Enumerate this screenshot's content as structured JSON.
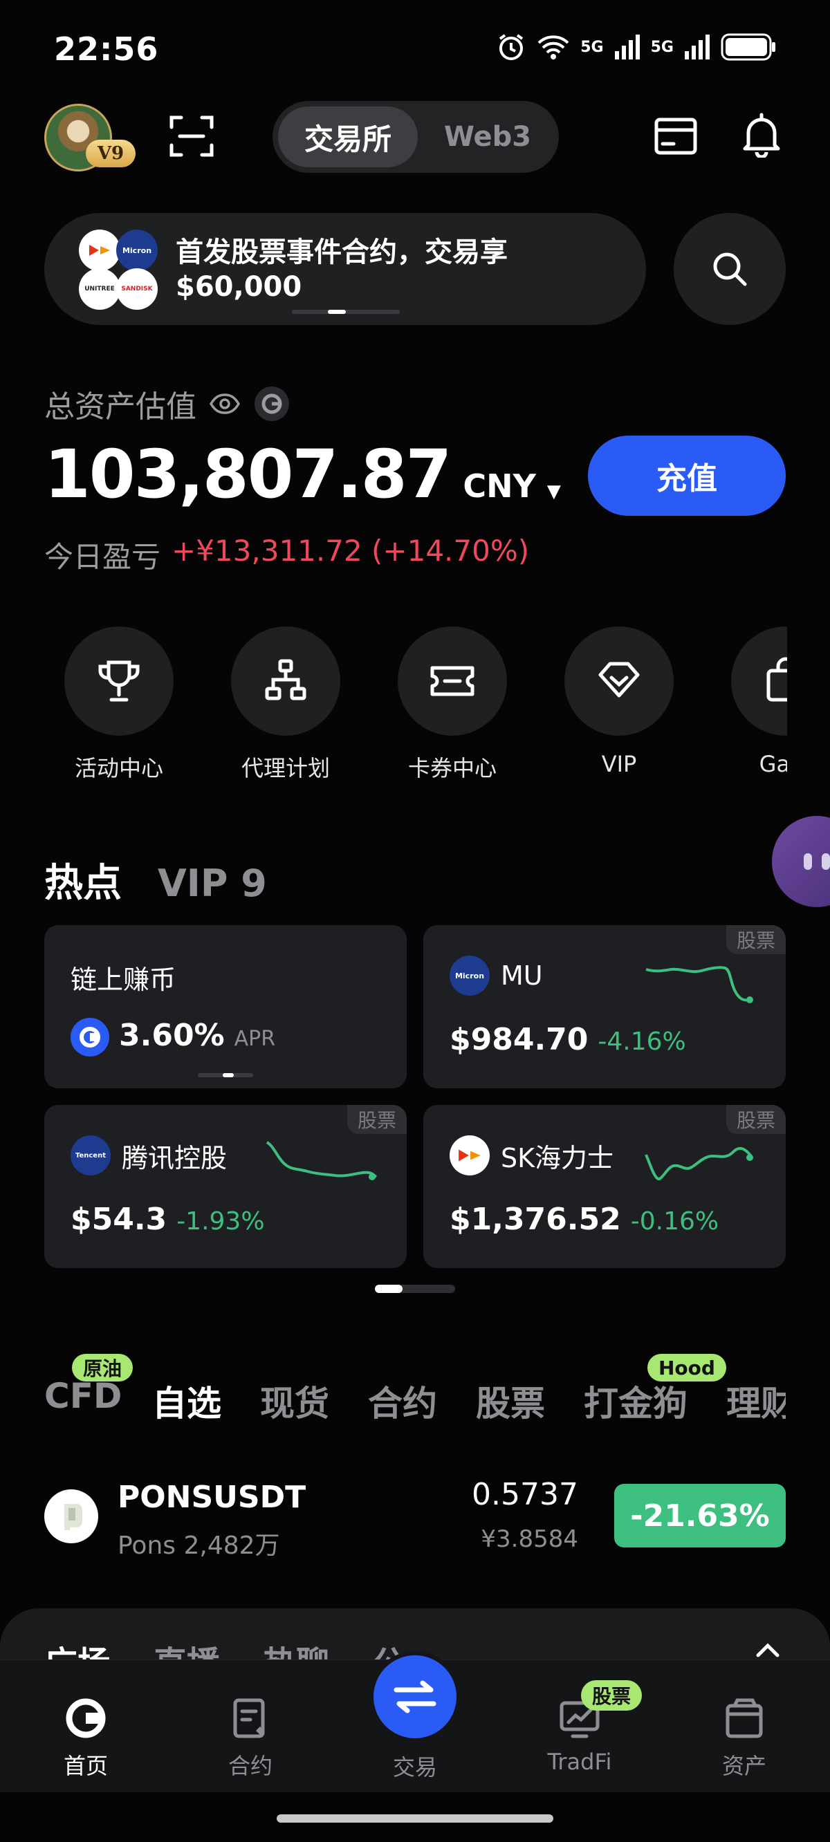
{
  "status_bar": {
    "time": "22:56",
    "signal_1": "5G",
    "signal_2": "5G"
  },
  "top_nav": {
    "vip_badge": "V9",
    "segments": {
      "active": "交易所",
      "inactive": "Web3"
    }
  },
  "banner": {
    "text": "首发股票事件合约，交易享$60,000",
    "logos": [
      "SK",
      "Micron",
      "UNITREE",
      "SANDISK"
    ]
  },
  "assets": {
    "label": "总资产估值",
    "value": "103,807.87",
    "currency": "CNY",
    "caret": "▼",
    "deposit_label": "充值",
    "pnl_label": "今日盈亏",
    "pnl_value": "+¥13,311.72 (+14.70%)"
  },
  "quick_actions": [
    {
      "label": "活动中心",
      "icon": "trophy-icon"
    },
    {
      "label": "代理计划",
      "icon": "org-chart-icon"
    },
    {
      "label": "卡券中心",
      "icon": "ticket-icon"
    },
    {
      "label": "VIP",
      "icon": "diamond-icon"
    },
    {
      "label": "Gate",
      "icon": "bag-icon"
    }
  ],
  "hot": {
    "title": "热点",
    "vip_tab": "VIP 9",
    "tiles": [
      {
        "name": "链上赚币",
        "price": "3.60%",
        "suffix": "APR",
        "tag": ""
      },
      {
        "name": "MU",
        "price": "$984.70",
        "change": "-4.16%",
        "tag": "股票",
        "logo": "Micron"
      },
      {
        "name": "腾讯控股",
        "price": "$54.3",
        "change": "-1.93%",
        "tag": "股票",
        "logo": "Tencent"
      },
      {
        "name": "SK海力士",
        "price": "$1,376.52",
        "change": "-0.16%",
        "tag": "股票",
        "logo": "SK"
      }
    ]
  },
  "market_tabs": {
    "tabs": [
      "CFD",
      "自选",
      "现货",
      "合约",
      "股票",
      "打金狗",
      "理财"
    ],
    "active": "自选",
    "badges": {
      "cfd": "原油",
      "dajingou": "Hood"
    }
  },
  "market_row": {
    "symbol": "PONSUSDT",
    "name": "Pons",
    "volume": "2,482万",
    "price": "0.5737",
    "price_cny": "¥3.8584",
    "change": "-21.63%"
  },
  "sheet": {
    "tabs": [
      "广场",
      "直播",
      "热聊",
      "公"
    ]
  },
  "bottom_nav": {
    "items": [
      "首页",
      "合约",
      "交易",
      "TradFi",
      "资产"
    ],
    "active": "首页",
    "tradfi_badge": "股票"
  },
  "colors": {
    "accent": "#2a5cf5",
    "up": "#f0495e",
    "down": "#3dbf7f",
    "badge_green": "#a8e872"
  }
}
